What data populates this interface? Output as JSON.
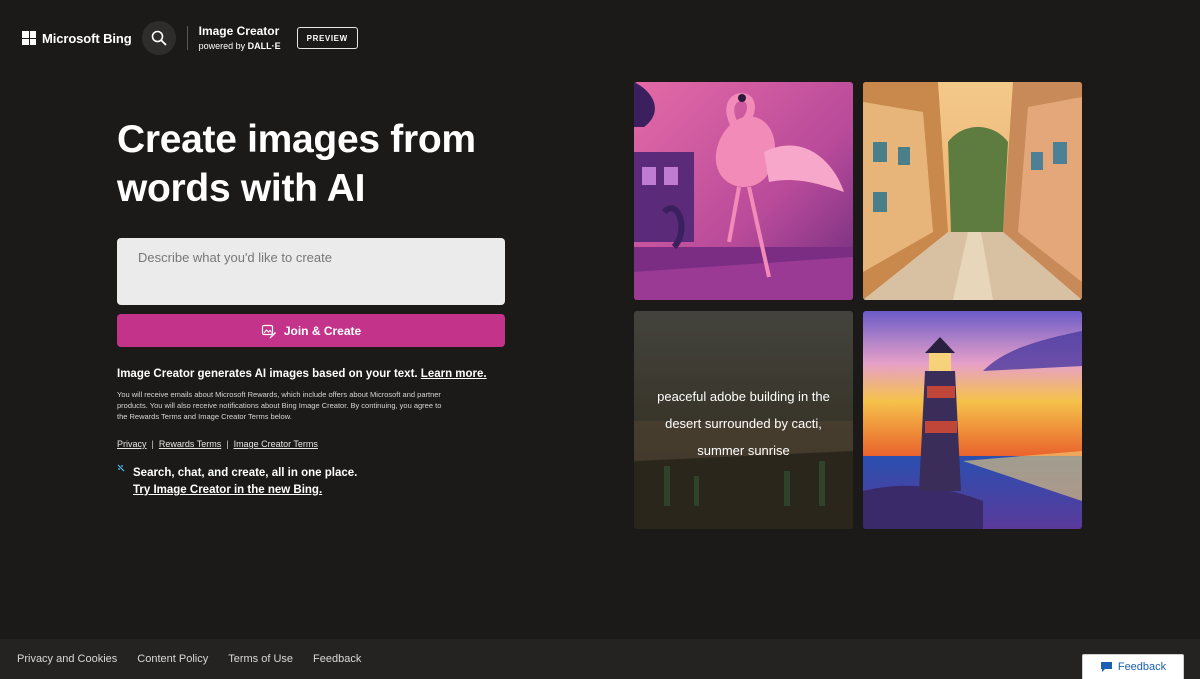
{
  "header": {
    "brand": "Microsoft Bing",
    "product_title": "Image Creator",
    "product_sub_prefix": "powered by",
    "product_sub_strong": "DALL·E",
    "badge": "PREVIEW",
    "icons": {
      "search": "search-icon",
      "logo": "microsoft-logo-icon"
    }
  },
  "hero": {
    "title_line1": "Create images from",
    "title_line2": "words with AI"
  },
  "prompt": {
    "placeholder": "Describe what you'd like to create",
    "value": ""
  },
  "join_button": {
    "label": "Join & Create",
    "icon": "image-edit-icon",
    "color": "#c4338a"
  },
  "info": {
    "text": "Image Creator generates AI images based on your text.",
    "link": "Learn more."
  },
  "fine_print": "You will receive emails about Microsoft Rewards, which include offers about Microsoft and partner products. You will also receive notifications about Bing Image Creator. By continuing, you agree to the Rewards Terms and Image Creator Terms below.",
  "terms": {
    "privacy": "Privacy",
    "rewards": "Rewards Terms",
    "image_creator": "Image Creator Terms",
    "separator": "|"
  },
  "promo": {
    "text": "Search, chat, and create, all in one place.",
    "link": "Try Image Creator in the new Bing.",
    "icon": "sparkle-icon"
  },
  "gallery": {
    "caption_3": "peaceful adobe building in the desert surrounded by cacti, summer sunrise"
  },
  "footer": {
    "links": [
      "Privacy and Cookies",
      "Content Policy",
      "Terms of Use",
      "Feedback"
    ]
  },
  "feedback_button": {
    "label": "Feedback",
    "icon": "feedback-icon"
  },
  "colors": {
    "background": "#1b1a19",
    "accent": "#c4338a",
    "footer": "#242322"
  }
}
